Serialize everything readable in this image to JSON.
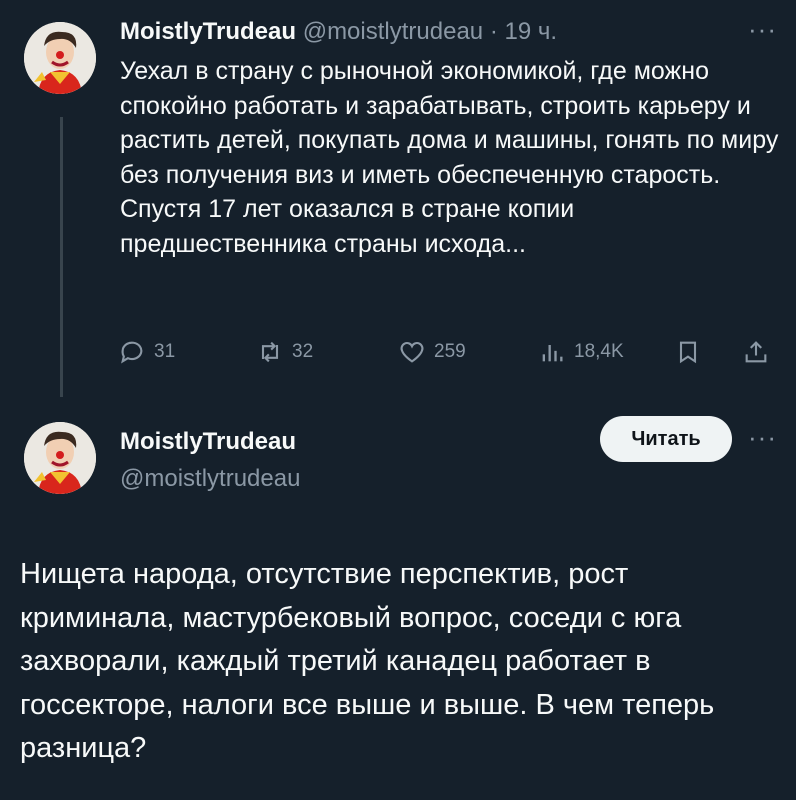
{
  "tweet1": {
    "name": "MoistlyTrudeau",
    "handle": "@moistlytrudeau",
    "separator": "·",
    "time": "19 ч.",
    "text": "Уехал в страну с рыночной экономикой, где можно спокойно работать и зарабатывать, строить карьеру и растить детей, покупать дома и машины, гонять по миру без получения виз и иметь обеспеченную старость. Спустя 17 лет оказался в стране копии предшественника страны исхода...",
    "more_icon": "ellipsis-icon",
    "actions": {
      "replies": "31",
      "reposts": "32",
      "likes": "259",
      "views": "18,4K"
    }
  },
  "tweet2": {
    "name": "MoistlyTrudeau",
    "handle": "@moistlytrudeau",
    "follow_label": "Читать",
    "text": "Нищета народа, отсутствие перспектив, рост криминала, мастурбековый вопрос, соседи с юга захворали, каждый третий канадец работает в госсекторе, налоги все выше и выше. В чем теперь разница?"
  },
  "more_glyph": "···",
  "colors": {
    "background": "#15202b",
    "text": "#f7f9f9",
    "muted": "#8b98a5",
    "thread_line": "#38444d",
    "follow_button": "#eff3f4"
  }
}
